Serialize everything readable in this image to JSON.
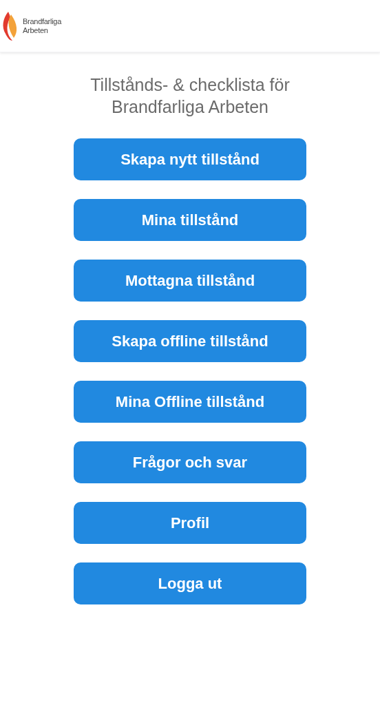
{
  "header": {
    "logo_text": [
      "Brandfarliga",
      "Arbeten"
    ]
  },
  "title": [
    "Tillstånds- & checklista för",
    "Brandfarliga Arbeten"
  ],
  "buttons": [
    "Skapa nytt tillstånd",
    "Mina tillstånd",
    "Mottagna tillstånd",
    "Skapa offline tillstånd",
    "Mina Offline tillstånd",
    "Frågor och svar",
    "Profil",
    "Logga ut"
  ]
}
